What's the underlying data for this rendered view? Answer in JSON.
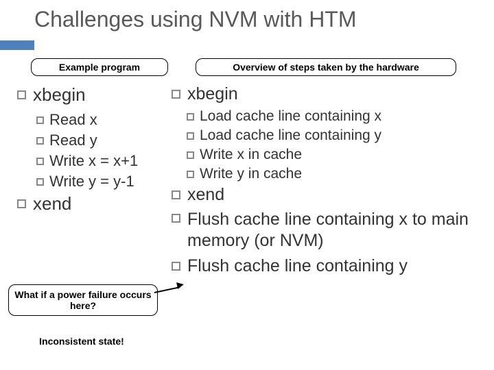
{
  "title": "Challenges using NVM with HTM",
  "labels": {
    "left": "Example program",
    "right": "Overview of steps taken by the hardware"
  },
  "left": {
    "begin": "xbegin",
    "items": [
      "Read x",
      "Read y",
      "Write x = x+1",
      "Write y = y-1"
    ],
    "end": "xend"
  },
  "right": {
    "begin": "xbegin",
    "items": [
      "Load cache line containing x",
      "Load cache line containing y",
      "Write x in cache",
      "Write y in cache"
    ],
    "end": "xend",
    "flush1": "Flush cache line containing x to main memory (or NVM)",
    "flush2": "Flush cache line containing y"
  },
  "callout1": "What if a power failure occurs here?",
  "callout2": "Inconsistent state!"
}
